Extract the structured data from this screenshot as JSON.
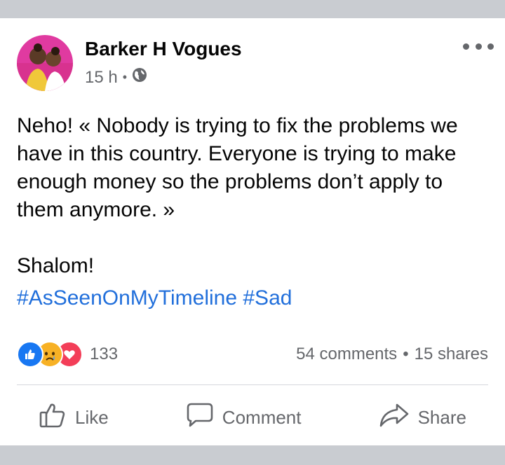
{
  "post": {
    "author": "Barker H Vogues",
    "time": "15 h",
    "separator": "•",
    "privacy_icon": "globe-icon",
    "menu_icon": "more-options-icon",
    "text_line1": "Neho! « Nobody is trying to fix the problems we have in this country. Everyone is trying to make enough money so the problems don’t apply to them anymore. »",
    "text_line2": "Shalom!",
    "hashtags": [
      "#AsSeenOnMyTimeline",
      "#Sad"
    ]
  },
  "engagement": {
    "reaction_icons": [
      "like-reaction-icon",
      "sad-reaction-icon",
      "love-reaction-icon"
    ],
    "reaction_count": "133",
    "comments": "54 comments",
    "separator": "•",
    "shares": "15 shares"
  },
  "actions": {
    "like_label": "Like",
    "comment_label": "Comment",
    "share_label": "Share"
  },
  "colors": {
    "hashtag": "#216fdb",
    "like_blue": "#1877f2",
    "love_red": "#f33e58",
    "sad_yellow": "#f7b125",
    "secondary_text": "#65676b"
  }
}
